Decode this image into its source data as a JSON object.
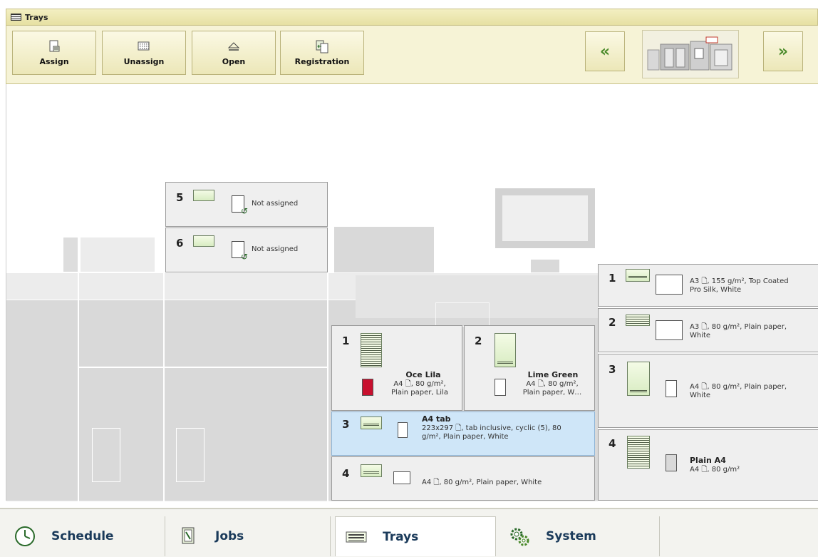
{
  "window": {
    "title": "Trays"
  },
  "toolbar": {
    "assign": "Assign",
    "unassign": "Unassign",
    "open": "Open",
    "registration": "Registration",
    "prev_icon": "chevron-left-icon",
    "next_icon": "chevron-right-icon"
  },
  "upper_trays": [
    {
      "number": "5",
      "status": "Not assigned"
    },
    {
      "number": "6",
      "status": "Not assigned"
    }
  ],
  "center_trays": [
    {
      "number": "1",
      "name": "Oce Lila",
      "line1": "A4 🗋, 80 g/m²,",
      "line2": "Plain paper, Lila",
      "color": "#c8102e"
    },
    {
      "number": "2",
      "name": "Lime Green",
      "line1": "A4 🗋, 80 g/m²,",
      "line2": "Plain paper, W…",
      "color": "#ffffff"
    },
    {
      "number": "3",
      "name": "A4 tab",
      "line1": "223x297 🗋, tab inclusive, cyclic (5), 80",
      "line2": "g/m², Plain paper, White",
      "selected": true
    },
    {
      "number": "4",
      "desc": "A4 🗋, 80 g/m², Plain paper, White"
    }
  ],
  "right_trays": [
    {
      "number": "1",
      "line1": "A3 🗋, 155 g/m², Top Coated",
      "line2": "Pro Silk, White"
    },
    {
      "number": "2",
      "line1": "A3 🗋, 80 g/m², Plain paper,",
      "line2": "White"
    },
    {
      "number": "3",
      "line1": "A4 🗋, 80 g/m², Plain paper,",
      "line2": "White"
    },
    {
      "number": "4",
      "name": "Plain A4",
      "line1": "A4 🗋, 80 g/m²",
      "color": "#d9d9d9"
    }
  ],
  "tabs": {
    "schedule": "Schedule",
    "jobs": "Jobs",
    "trays": "Trays",
    "system": "System"
  },
  "colors": {
    "toolbar_bg": "#f6f3d6",
    "selected_tray": "#cfe6f8",
    "accent_green": "#4a8a2a"
  }
}
